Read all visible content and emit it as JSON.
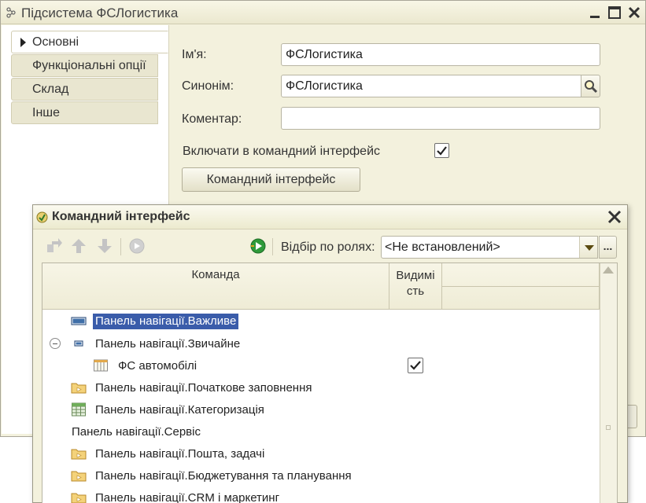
{
  "main_window": {
    "title": "Підсистема ФСЛогистика",
    "tabs": [
      {
        "label": "Основні",
        "active": true
      },
      {
        "label": "Функціональні опції",
        "active": false
      },
      {
        "label": "Склад",
        "active": false
      },
      {
        "label": "Інше",
        "active": false
      }
    ],
    "form": {
      "name_label": "Ім'я:",
      "name_value": "ФСЛогистика",
      "synonym_label": "Синонім:",
      "synonym_value": "ФСЛогистика",
      "comment_label": "Коментар:",
      "comment_value": "",
      "include_label": "Включати в командний інтерфейс",
      "include_checked": true,
      "command_interface_button": "Командний інтерфейс"
    }
  },
  "dialog": {
    "title": "Командний інтерфейс",
    "toolbar": {
      "roles_label": "Відбір по ролях:",
      "roles_value": "<Не встановлений>",
      "more_label": "..."
    },
    "grid": {
      "columns": {
        "command": "Команда",
        "visibility": "Видимість",
        "visibility_line1": "Видимі",
        "visibility_line2": "сть"
      },
      "rows": [
        {
          "text": "Панель навігації.Важливе",
          "icon": "panel-wide-icon",
          "selected": true
        },
        {
          "text": "Панель навігації.Звичайне",
          "icon": "panel-small-icon",
          "expanded": true
        },
        {
          "text": "ФС автомобілі",
          "icon": "catalog-icon",
          "indent": true,
          "visible_checked": true
        },
        {
          "text": "Панель навігації.Початкове заповнення",
          "icon": "folder-icon"
        },
        {
          "text": "Панель навігації.Категоризація",
          "icon": "grid-table-icon"
        },
        {
          "text": "Панель навігації.Сервіс",
          "icon": "none"
        },
        {
          "text": "Панель навігації.Пошта, задачі",
          "icon": "folder-icon"
        },
        {
          "text": "Панель навігації.Бюджетування та планування",
          "icon": "folder-icon"
        },
        {
          "text": "Панель навігації.CRM і маркетинг",
          "icon": "folder-icon"
        }
      ]
    }
  },
  "colors": {
    "window_bg": "#f3f1dd",
    "selection_bg": "#3a5caa",
    "tab_bg": "#e9e6d0"
  }
}
